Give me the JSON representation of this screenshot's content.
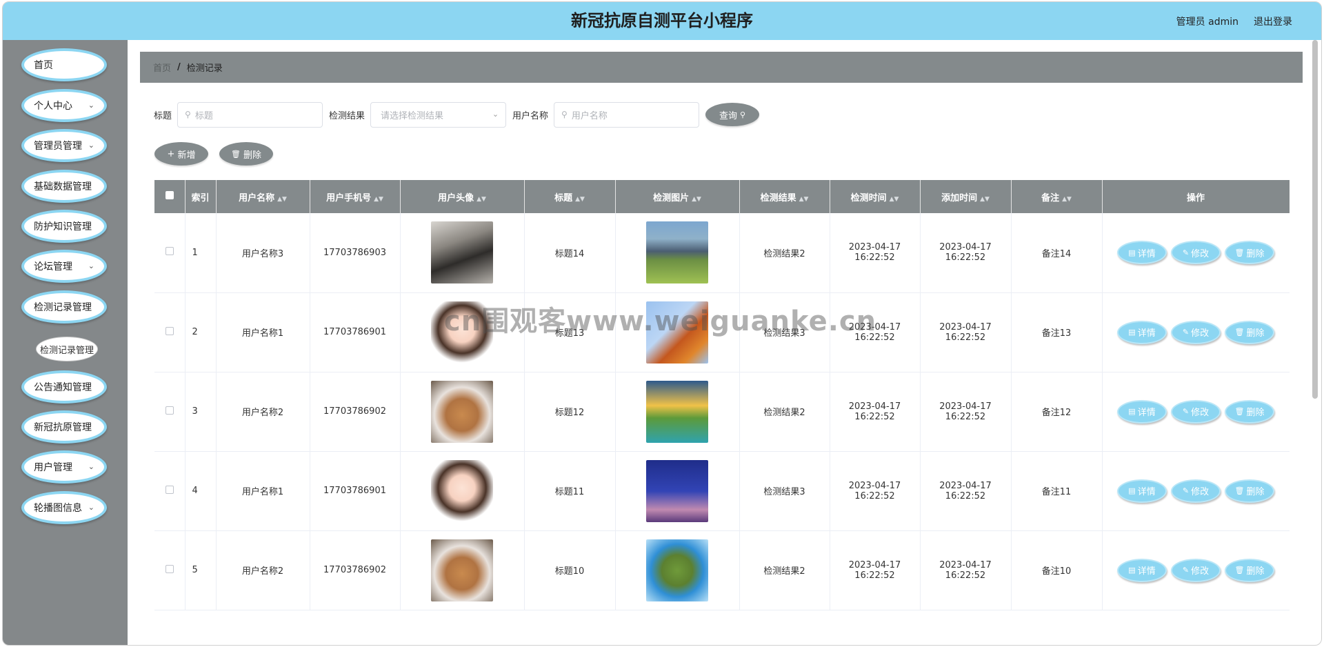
{
  "header": {
    "title": "新冠抗原自测平台小程序",
    "admin": "管理员 admin",
    "logout": "退出登录"
  },
  "sidebar": {
    "items": [
      {
        "label": "首页",
        "chevron": false
      },
      {
        "label": "个人中心",
        "chevron": true
      },
      {
        "label": "管理员管理",
        "chevron": true
      },
      {
        "label": "基础数据管理",
        "chevron": true
      },
      {
        "label": "防护知识管理",
        "chevron": true
      },
      {
        "label": "论坛管理",
        "chevron": true
      },
      {
        "label": "检测记录管理",
        "chevron": true
      },
      {
        "label": "公告通知管理",
        "chevron": true
      },
      {
        "label": "新冠抗原管理",
        "chevron": true
      },
      {
        "label": "用户管理",
        "chevron": true
      },
      {
        "label": "轮播图信息",
        "chevron": true
      }
    ],
    "sub_item": "检测记录管理"
  },
  "breadcrumb": {
    "home": "首页",
    "separator": "/",
    "current": "检测记录"
  },
  "search": {
    "title_label": "标题",
    "title_placeholder": "标题",
    "result_label": "检测结果",
    "result_placeholder": "请选择检测结果",
    "user_label": "用户名称",
    "user_placeholder": "用户名称",
    "query_button": "查询"
  },
  "actions": {
    "add": "新增",
    "delete": "删除"
  },
  "table": {
    "headers": [
      "索引",
      "用户名称",
      "用户手机号",
      "用户头像",
      "标题",
      "检测图片",
      "检测结果",
      "检测时间",
      "添加时间",
      "备注",
      "操作"
    ],
    "rows": [
      {
        "index": "1",
        "user": "用户名称3",
        "phone": "17703786903",
        "title": "标题14",
        "result": "检测结果2",
        "test_time": "2023-04-17 16:22:52",
        "add_time": "2023-04-17 16:22:52",
        "note": "备注14"
      },
      {
        "index": "2",
        "user": "用户名称1",
        "phone": "17703786901",
        "title": "标题13",
        "result": "检测结果3",
        "test_time": "2023-04-17 16:22:52",
        "add_time": "2023-04-17 16:22:52",
        "note": "备注13"
      },
      {
        "index": "3",
        "user": "用户名称2",
        "phone": "17703786902",
        "title": "标题12",
        "result": "检测结果2",
        "test_time": "2023-04-17 16:22:52",
        "add_time": "2023-04-17 16:22:52",
        "note": "备注12"
      },
      {
        "index": "4",
        "user": "用户名称1",
        "phone": "17703786901",
        "title": "标题11",
        "result": "检测结果3",
        "test_time": "2023-04-17 16:22:52",
        "add_time": "2023-04-17 16:22:52",
        "note": "备注11"
      },
      {
        "index": "5",
        "user": "用户名称2",
        "phone": "17703786902",
        "title": "标题10",
        "result": "检测结果2",
        "test_time": "2023-04-17 16:22:52",
        "add_time": "2023-04-17 16:22:52",
        "note": "备注10"
      }
    ],
    "row_actions": {
      "detail": "详情",
      "edit": "修改",
      "delete": "删除"
    }
  },
  "watermark": "cn围观客www.weiguanke.cn",
  "colors": {
    "header": "#8cd6f2",
    "sidebar": "#84888a",
    "accent": "#8cd6f2"
  }
}
